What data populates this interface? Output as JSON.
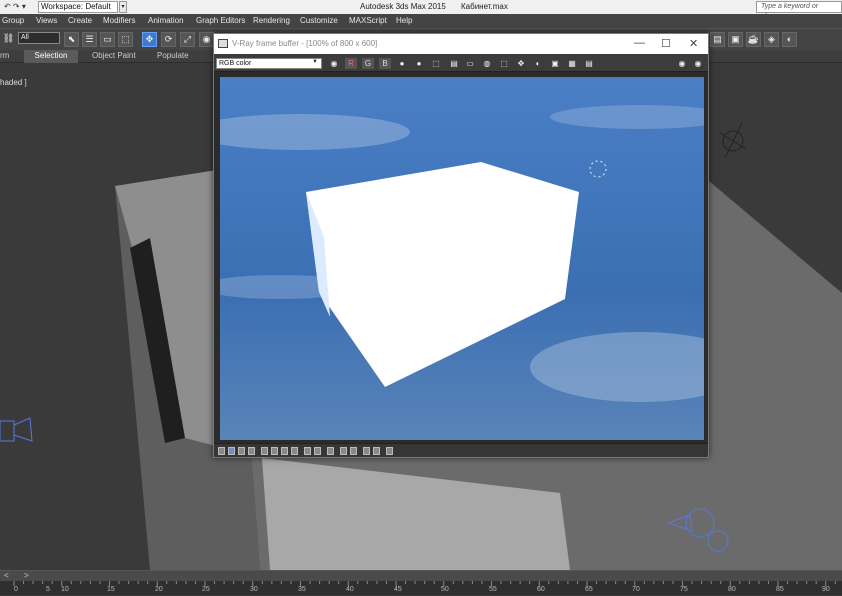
{
  "titlebar": {
    "quick_access": "↶ ↷ ▾",
    "workspace": "Workspace: Default",
    "app_title": "Autodesk 3ds Max  2015",
    "file_name": "Кабинет.max",
    "search_placeholder": "Type a keyword or phrase"
  },
  "menu": [
    "Group",
    "Views",
    "Create",
    "Modifiers",
    "Animation",
    "Graph Editors",
    "Rendering",
    "Customize",
    "MAXScript",
    "Help"
  ],
  "toolbar": {
    "selection_filter": "All"
  },
  "ribbon": {
    "tabs": [
      "rm",
      "Selection",
      "Object Paint",
      "Populate"
    ]
  },
  "viewport": {
    "label": "haded ]"
  },
  "vfb": {
    "title": "V-Ray frame buffer - [100% of 800 x 600]",
    "channel": "RGB color",
    "btn_r": "R",
    "btn_g": "G",
    "btn_b": "B"
  },
  "timeline": {
    "left_btn": "<",
    "right_btn": ">",
    "ticks": [
      "0",
      "5",
      "10",
      "15",
      "20",
      "25",
      "30",
      "35",
      "40",
      "45",
      "50",
      "55",
      "60",
      "65",
      "70",
      "75",
      "80",
      "85",
      "90"
    ]
  },
  "colors": {
    "render_sky": "#3d70b5",
    "accent": "#3a7bd5"
  }
}
